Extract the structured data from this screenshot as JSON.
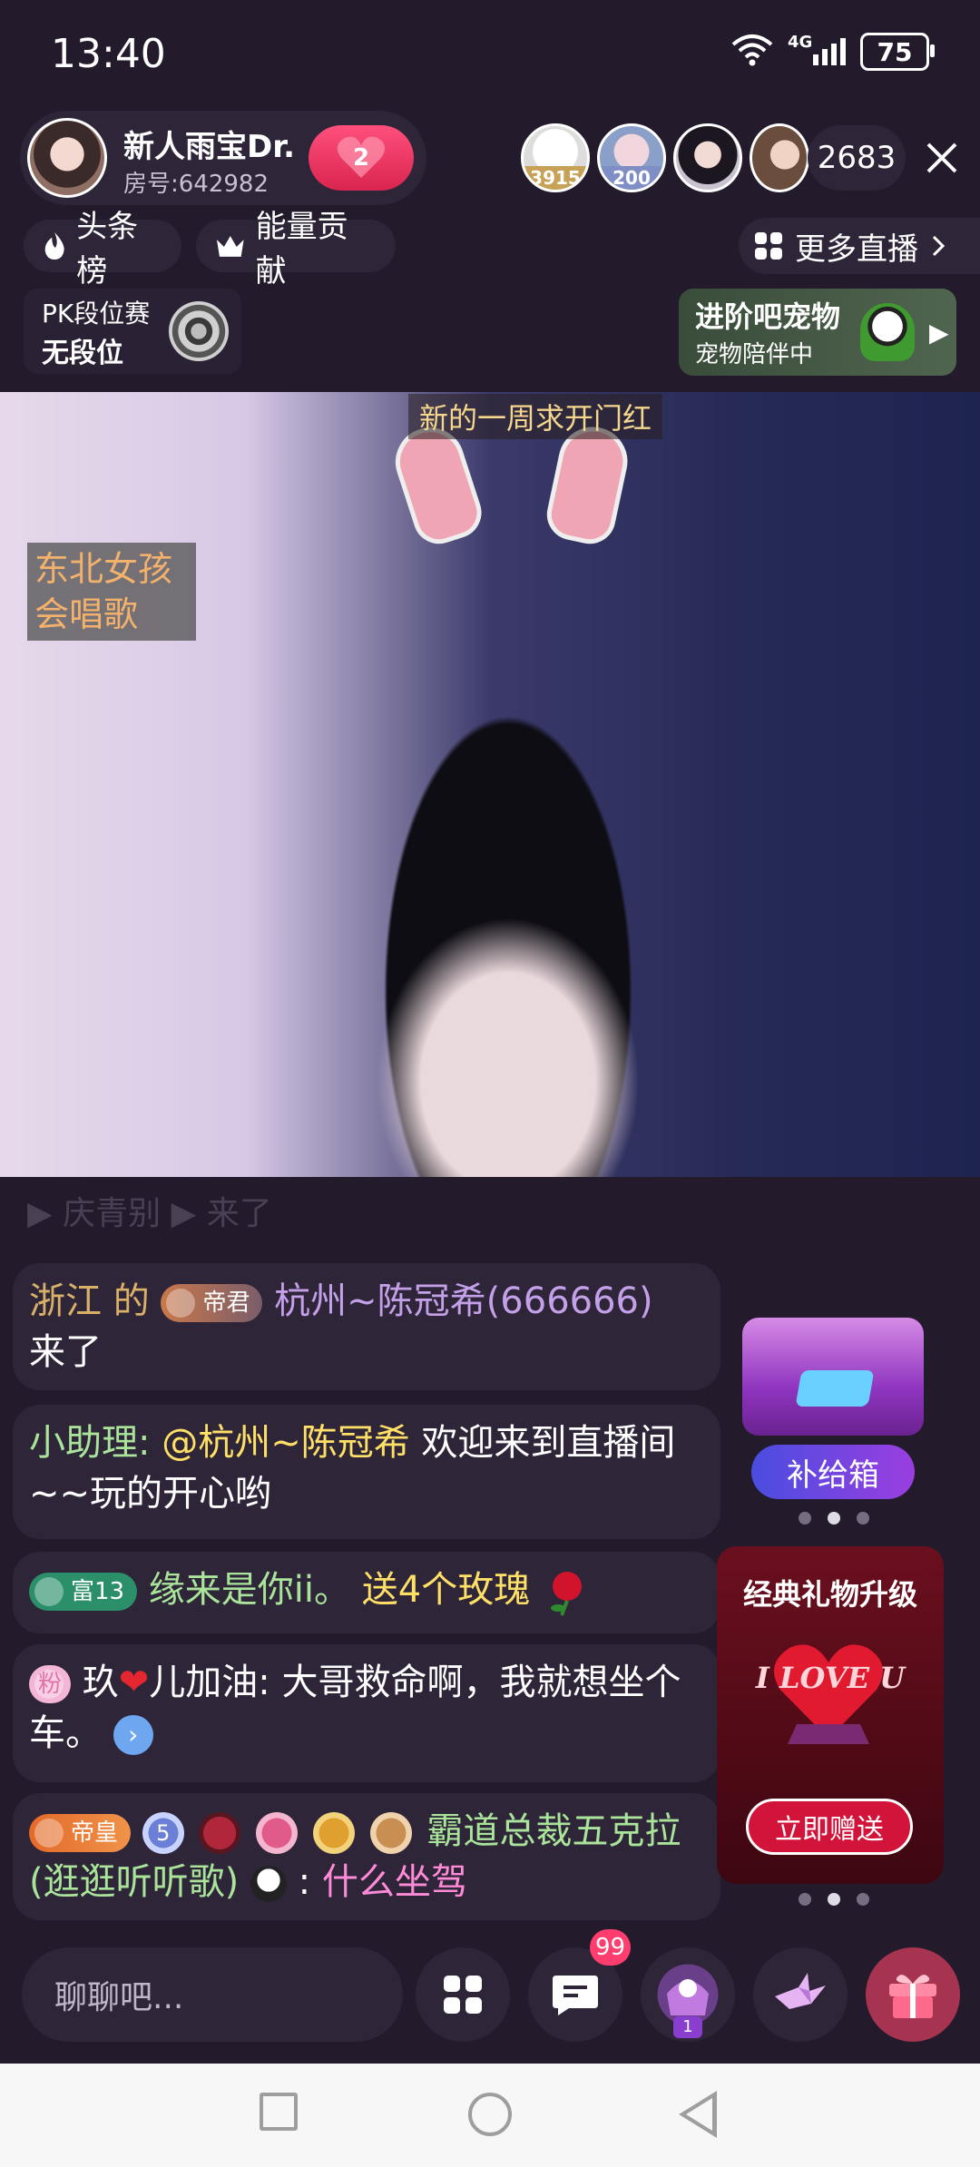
{
  "status_bar": {
    "time": "13:40",
    "network": "4G",
    "battery": "75"
  },
  "host": {
    "name": "新人雨宝Dr.",
    "room_label": "房号:642982",
    "follow_count": "2"
  },
  "viewers": [
    {
      "badge": "3915"
    },
    {
      "badge": "200"
    },
    {
      "badge": ""
    },
    {
      "badge": ""
    }
  ],
  "viewer_count": "2683",
  "rank_chips": {
    "headline": "头条榜",
    "energy": "能量贡献",
    "more_live": "更多直播"
  },
  "pk": {
    "title": "PK段位赛",
    "rank": "无段位"
  },
  "pet": {
    "title": "进阶吧宠物",
    "subtitle": "宠物陪伴中"
  },
  "video": {
    "caption": "新的一周求开门红",
    "tag": [
      "东北女孩",
      "会唱歌"
    ]
  },
  "chat": {
    "faded": "▶ 庆青别 ▶ 来了",
    "messages": [
      {
        "region": "浙江",
        "of": " 的 ",
        "badge": "帝君",
        "user": "杭州~陈冠希(666666)",
        "text": "来了"
      },
      {
        "sender": "小助理:",
        "mention": "@杭州~陈冠希",
        "text": " 欢迎来到直播间~~玩的开心哟"
      },
      {
        "badge": "富13",
        "user": "缘来是你ii。",
        "gift": "送4个玫瑰"
      },
      {
        "badge": "粉",
        "user_pre": "玖",
        "user_post": "儿加油:",
        "text": " 大哥救命啊，我就想坐个车。"
      },
      {
        "badge": "帝皇",
        "medal_level": "5",
        "user": "霸道总裁五克拉(逛逛听听歌)",
        "sep": " : ",
        "text": "什么坐驾"
      }
    ]
  },
  "supply_box": {
    "label": "补给箱"
  },
  "gift_promo": {
    "title": "经典礼物升级",
    "art_text": "I LOVE U",
    "button": "立即赠送"
  },
  "bottom": {
    "chat_placeholder": "聊聊吧...",
    "message_badge": "99",
    "seat_badge": "1"
  },
  "colors": {
    "background": "#231b2c",
    "panel": "#2e2539",
    "accent_pink": "#ff3d6e",
    "gift_red": "#d3143a"
  }
}
